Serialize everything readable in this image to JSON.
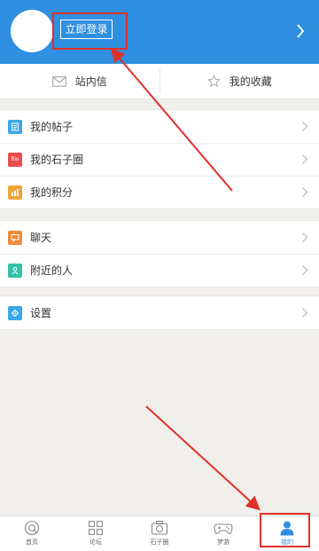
{
  "header": {
    "login_label": "立即登录",
    "bg_color": "#2f8fe0"
  },
  "quick_actions": [
    {
      "label": "站内信",
      "icon": "envelope-icon"
    },
    {
      "label": "我的收藏",
      "icon": "star-icon"
    }
  ],
  "menu_groups": [
    [
      {
        "label": "我的帖子",
        "icon": "document-icon",
        "color": "#3aa7e6"
      },
      {
        "label": "我的石子圈",
        "icon_text": "Biu",
        "icon": "biu-icon",
        "color": "#e84c4c"
      },
      {
        "label": "我的积分",
        "icon": "points-icon",
        "color": "#f0a53a"
      }
    ],
    [
      {
        "label": "聊天",
        "icon": "chat-icon",
        "color": "#f08a3a"
      },
      {
        "label": "附近的人",
        "icon": "nearby-person-icon",
        "color": "#35c2a8"
      }
    ],
    [
      {
        "label": "设置",
        "icon": "gear-icon",
        "color": "#3aa7e6"
      }
    ]
  ],
  "tabbar": [
    {
      "label": "首页",
      "icon": "home-icon",
      "active": false
    },
    {
      "label": "论坛",
      "icon": "forum-grid-icon",
      "active": false
    },
    {
      "label": "石子圈",
      "icon": "camera-icon",
      "active": false
    },
    {
      "label": "梦游",
      "icon": "gamepad-icon",
      "active": false
    },
    {
      "label": "我的",
      "icon": "profile-icon",
      "active": true
    }
  ],
  "annotation_color": "#e0302a"
}
